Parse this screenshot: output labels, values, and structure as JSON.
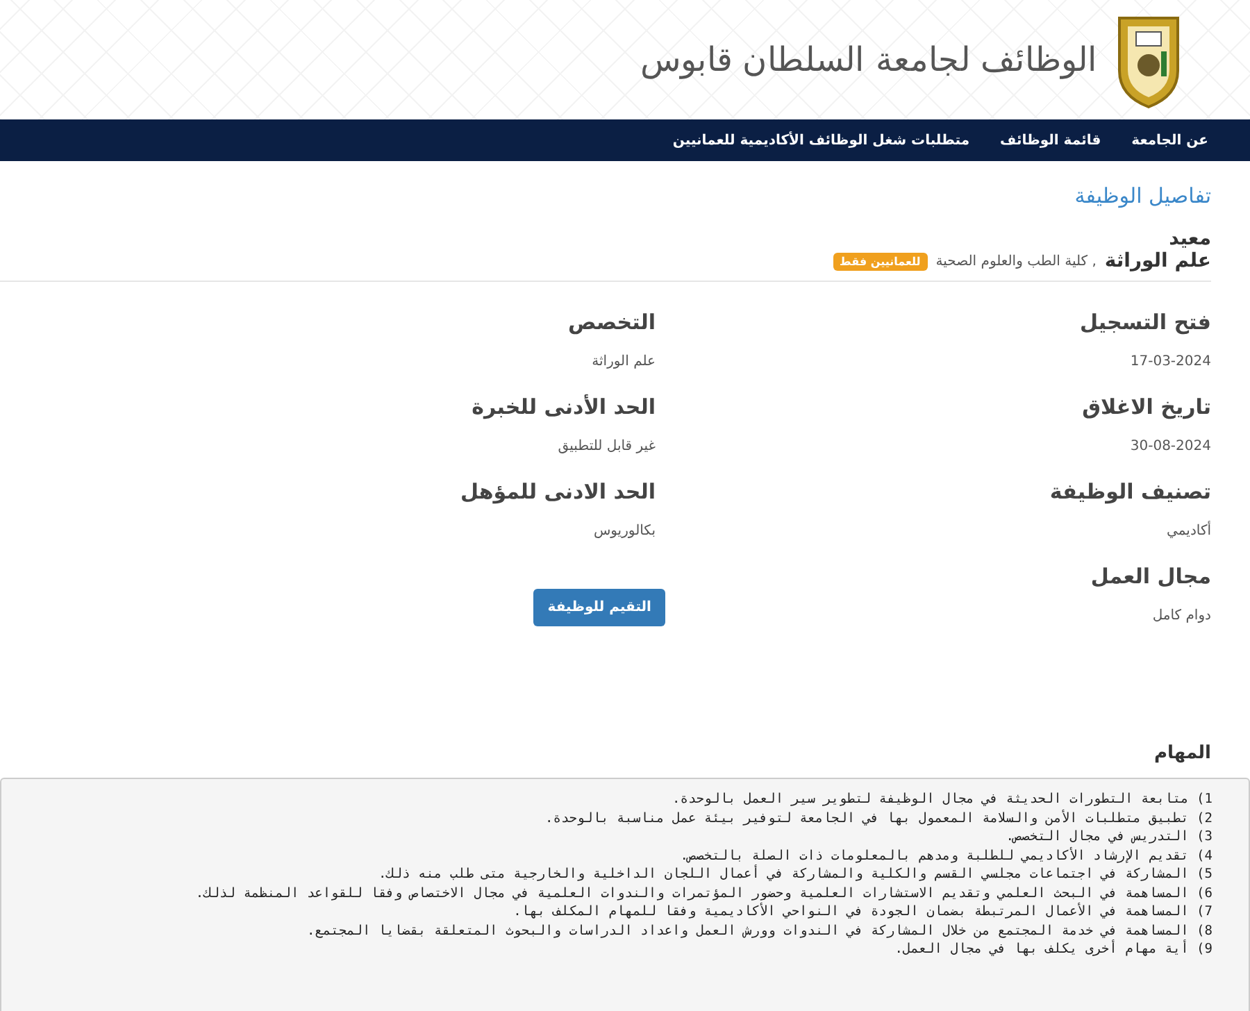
{
  "header": {
    "title": "الوظائف لجامعة السلطان قابوس"
  },
  "nav": {
    "items": [
      "عن الجامعة",
      "قائمة الوظائف",
      "متطلبات شغل الوظائف الأكاديمية للعمانيين"
    ]
  },
  "page_title": "تفاصيل الوظيفة",
  "job": {
    "title": "معيد",
    "specialty": "علم الوراثة",
    "college": ", كلية الطب والعلوم الصحية",
    "badge": "للعمانيين فقط"
  },
  "details_right": [
    {
      "label": "فتح التسجيل",
      "value": "17-03-2024"
    },
    {
      "label": "تاريخ الاغلاق",
      "value": "30-08-2024"
    },
    {
      "label": "تصنيف الوظيفة",
      "value": "أكاديمي"
    },
    {
      "label": "مجال العمل",
      "value": "دوام كامل"
    }
  ],
  "details_left": [
    {
      "label": "التخصص",
      "value": "علم الوراثة"
    },
    {
      "label": "الحد الأدنى للخبرة",
      "value": "غير قابل للتطبيق"
    },
    {
      "label": "الحد الادنى للمؤهل",
      "value": "بكالوريوس"
    }
  ],
  "apply_button": "التقيم للوظيفة",
  "tasks": {
    "heading": "المهام",
    "lines": [
      "1) متابعة التطورات الحديثة في مجال الوظيفة لتطوير سير العمل بالوحدة.",
      "2) تطبيق متطلبات الأمن والسلامة المعمول بها في الجامعة لتوفير بيئة عمل مناسبة بالوحدة.",
      "3) التدريس في مجال التخصص.",
      "4) تقديم الإرشاد الأكاديمي للطلبة ومدهم بالمعلومات ذات الصلة بالتخصص.",
      "5) المشاركة في اجتماعات مجلسي القسم والكلية والمشاركة في أعمال اللجان الداخلية والخارجية متى طلب منه ذلك.",
      "6) المساهمة في البحث العلمي وتقديم الاستشارات العلمية وحضور المؤتمرات والندوات العلمية في مجال الاختصاص وفقا للقواعد المنظمة لذلك.",
      "7) المساهمة في الأعمال المرتبطة بضمان الجودة في النواحي الأكاديمية وفقا للمهام المكلف بها.",
      "8) المساهمة في خدمة المجتمع من خلال المشاركة في الندوات وورش العمل واعداد الدراسات والبحوث المتعلقة بقضايا المجتمع.",
      "9) أية مهام أخرى يكلف بها في مجال العمل."
    ]
  }
}
